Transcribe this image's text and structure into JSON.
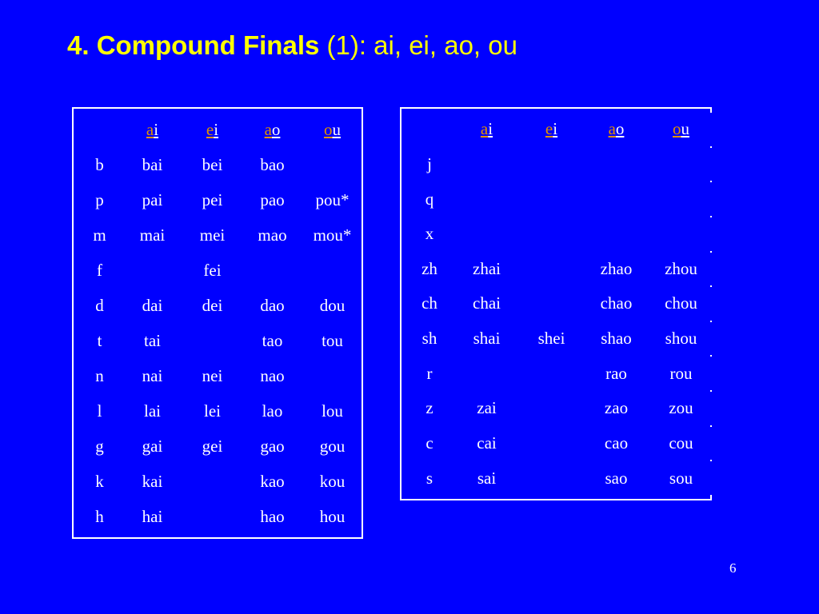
{
  "slide": {
    "title_bold": "4. Compound Finals",
    "title_rest": " (1): ai, ei, ao, ou",
    "page_number": "6",
    "background_color": "#0000ff",
    "title_color": "#ffff00"
  },
  "colors": {
    "background": "#0000ff",
    "column_header_bg": "#0a6b0a",
    "row_header_bg": "#0a9b0a",
    "cell_bg": "#0000ff",
    "grid_line": "#ffffff",
    "text": "#ffffff",
    "header_accent": "#e09000"
  },
  "column_headers": [
    {
      "lead": "a",
      "tail": "i",
      "full": "ai"
    },
    {
      "lead": "e",
      "tail": "i",
      "full": "ei"
    },
    {
      "lead": "a",
      "tail": "o",
      "full": "ao"
    },
    {
      "lead": "o",
      "tail": "u",
      "full": "ou"
    }
  ],
  "table_left": {
    "corner": "",
    "rows": [
      {
        "initial": "b",
        "cells": [
          "bai",
          "bei",
          "bao",
          ""
        ]
      },
      {
        "initial": "p",
        "cells": [
          "pai",
          "pei",
          "pao",
          "pou*"
        ]
      },
      {
        "initial": "m",
        "cells": [
          "mai",
          "mei",
          "mao",
          "mou*"
        ]
      },
      {
        "initial": "f",
        "cells": [
          "",
          "fei",
          "",
          ""
        ]
      },
      {
        "initial": "d",
        "cells": [
          "dai",
          "dei",
          "dao",
          "dou"
        ]
      },
      {
        "initial": "t",
        "cells": [
          "tai",
          "",
          "tao",
          "tou"
        ]
      },
      {
        "initial": "n",
        "cells": [
          "nai",
          "nei",
          "nao",
          ""
        ]
      },
      {
        "initial": "l",
        "cells": [
          "lai",
          "lei",
          "lao",
          "lou"
        ]
      },
      {
        "initial": "g",
        "cells": [
          "gai",
          "gei",
          "gao",
          "gou"
        ]
      },
      {
        "initial": "k",
        "cells": [
          "kai",
          "",
          "kao",
          "kou"
        ]
      },
      {
        "initial": "h",
        "cells": [
          "hai",
          "",
          "hao",
          "hou"
        ]
      }
    ]
  },
  "table_right": {
    "corner": "",
    "rows": [
      {
        "initial": "j",
        "cells": [
          "",
          "",
          "",
          ""
        ]
      },
      {
        "initial": "q",
        "cells": [
          "",
          "",
          "",
          ""
        ]
      },
      {
        "initial": "x",
        "cells": [
          "",
          "",
          "",
          ""
        ]
      },
      {
        "initial": "zh",
        "cells": [
          "zhai",
          "",
          "zhao",
          "zhou"
        ]
      },
      {
        "initial": "ch",
        "cells": [
          "chai",
          "",
          "chao",
          "chou"
        ]
      },
      {
        "initial": "sh",
        "cells": [
          "shai",
          "shei",
          "shao",
          "shou"
        ]
      },
      {
        "initial": "r",
        "cells": [
          "",
          "",
          "rao",
          "rou"
        ]
      },
      {
        "initial": "z",
        "cells": [
          "zai",
          "",
          "zao",
          "zou"
        ]
      },
      {
        "initial": "c",
        "cells": [
          "cai",
          "",
          "cao",
          "cou"
        ]
      },
      {
        "initial": "s",
        "cells": [
          "sai",
          "",
          "sao",
          "sou"
        ]
      }
    ]
  }
}
